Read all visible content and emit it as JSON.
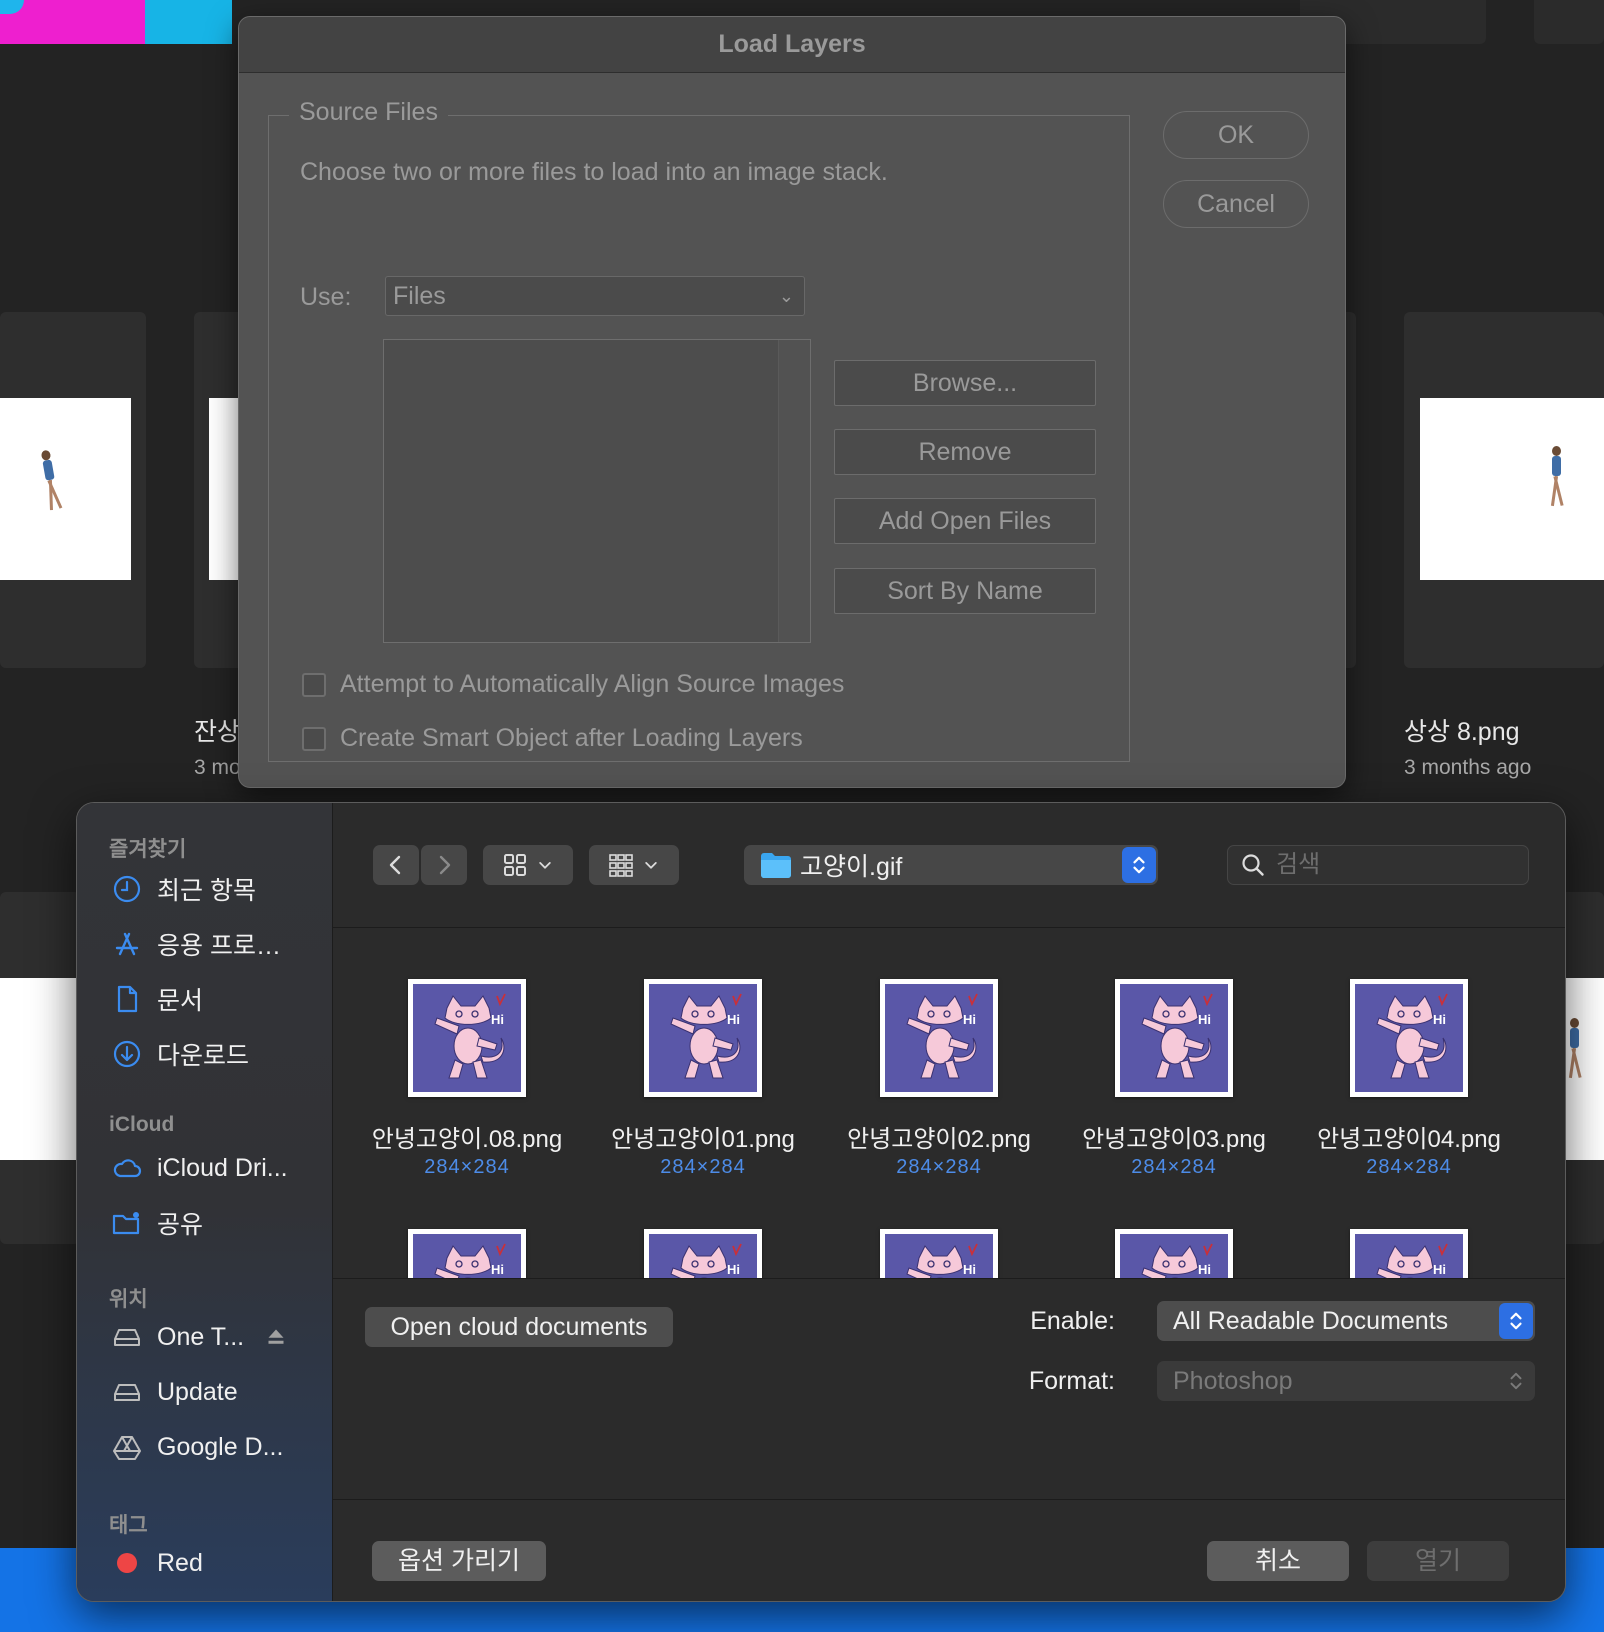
{
  "background": {
    "cards": [
      {
        "name": "잔상",
        "date": "3 mo"
      },
      {
        "name": "상상 8.png",
        "date": "3 months ago"
      }
    ]
  },
  "load_layers": {
    "title": "Load Layers",
    "group_label": "Source Files",
    "description": "Choose two or more files to load into an image stack.",
    "use_label": "Use:",
    "use_value": "Files",
    "buttons": {
      "browse": "Browse...",
      "remove": "Remove",
      "add_open_files": "Add Open Files",
      "sort_by_name": "Sort By Name"
    },
    "checkboxes": {
      "align": "Attempt to Automatically Align Source Images",
      "smart_object": "Create Smart Object after Loading Layers"
    },
    "ok": "OK",
    "cancel": "Cancel"
  },
  "open_panel": {
    "sidebar": {
      "favorites_header": "즐겨찾기",
      "favorites": [
        {
          "label": "최근 항목",
          "icon": "clock-icon"
        },
        {
          "label": "응용 프로…",
          "icon": "app-store-icon"
        },
        {
          "label": "문서",
          "icon": "document-icon"
        },
        {
          "label": "다운로드",
          "icon": "download-icon"
        }
      ],
      "icloud_header": "iCloud",
      "icloud": [
        {
          "label": "iCloud Dri...",
          "icon": "cloud-icon"
        },
        {
          "label": "공유",
          "icon": "shared-folder-icon"
        }
      ],
      "locations_header": "위치",
      "locations": [
        {
          "label": "One T...",
          "icon": "drive-icon"
        },
        {
          "label": "Update",
          "icon": "drive-icon"
        },
        {
          "label": "Google D...",
          "icon": "google-drive-icon"
        }
      ],
      "tags_header": "태그",
      "tags": [
        {
          "label": "Red",
          "color": "#ee4545"
        }
      ]
    },
    "toolbar": {
      "current_folder": "고양이.gif",
      "search_placeholder": "검색"
    },
    "files": [
      {
        "name": "안녕고양이.08.png",
        "dims": "284×284"
      },
      {
        "name": "안녕고양이01.png",
        "dims": "284×284"
      },
      {
        "name": "안녕고양이02.png",
        "dims": "284×284"
      },
      {
        "name": "안녕고양이03.png",
        "dims": "284×284"
      },
      {
        "name": "안녕고양이04.png",
        "dims": "284×284"
      }
    ],
    "cloud_button": "Open cloud documents",
    "enable_label": "Enable:",
    "enable_value": "All Readable Documents",
    "format_label": "Format:",
    "format_value": "Photoshop",
    "options_button": "옵션 가리기",
    "cancel_button": "취소",
    "open_button": "열기",
    "colors": {
      "accent": "#2d6fe3",
      "thumb_bg": "#5a57a8",
      "cat": "#f6c9d9",
      "dims_text": "#4d8ce8"
    }
  }
}
